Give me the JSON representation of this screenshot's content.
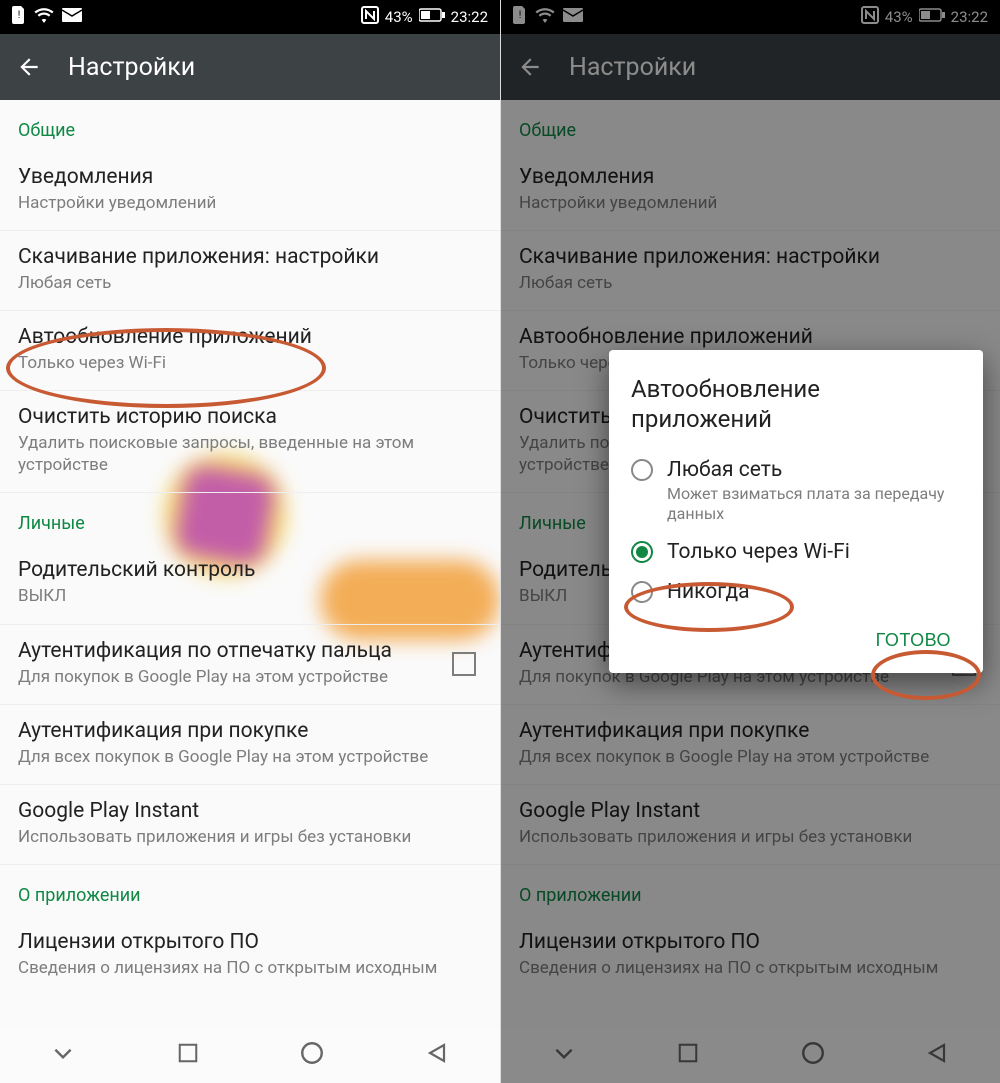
{
  "status": {
    "battery_pct": "43%",
    "time": "23:22"
  },
  "header": {
    "title": "Настройки"
  },
  "sections": {
    "general": {
      "label": "Общие",
      "notifications": {
        "title": "Уведомления",
        "subtitle": "Настройки уведомлений"
      },
      "download": {
        "title": "Скачивание приложения: настройки",
        "subtitle": "Любая сеть"
      },
      "autoupdate": {
        "title": "Автообновление приложений",
        "subtitle": "Только через Wi-Fi"
      },
      "clear_search": {
        "title": "Очистить историю поиска",
        "subtitle": "Удалить поисковые запросы, введенные на этом устройстве"
      }
    },
    "personal": {
      "label": "Личные",
      "parental": {
        "title": "Родительский контроль",
        "subtitle": "ВЫКЛ"
      },
      "fingerprint": {
        "title": "Аутентификация по отпечатку пальца",
        "subtitle": "Для покупок в Google Play на этом устройстве"
      },
      "purchase": {
        "title": "Аутентификация при покупке",
        "subtitle": "Для всех покупок в Google Play на этом устройстве"
      },
      "instant": {
        "title": "Google Play Instant",
        "subtitle": "Использовать приложения и игры без установки"
      }
    },
    "about": {
      "label": "О приложении",
      "licenses": {
        "title": "Лицензии открытого ПО",
        "subtitle": "Сведения о лицензиях на ПО с открытым исходным"
      }
    }
  },
  "dialog": {
    "title": "Автообновление приложений",
    "options": [
      {
        "title": "Любая сеть",
        "subtitle": "Может взиматься плата за передачу данных",
        "selected": false
      },
      {
        "title": "Только через Wi-Fi",
        "subtitle": "",
        "selected": true
      },
      {
        "title": "Никогда",
        "subtitle": "",
        "selected": false
      }
    ],
    "done": "ГОТОВО"
  },
  "icons": {
    "sim": "sim-icon",
    "wifi": "wifi-icon",
    "mail": "mail-icon",
    "nfc": "nfc-icon",
    "battery": "battery-icon",
    "back": "back-arrow-icon",
    "nav": {
      "expand": "expand-icon",
      "recents": "recents-icon",
      "home": "home-icon",
      "backnav": "back-nav-icon"
    }
  },
  "colors": {
    "accent": "#108844",
    "annotation": "#c85a33",
    "header": "#3d4245"
  }
}
